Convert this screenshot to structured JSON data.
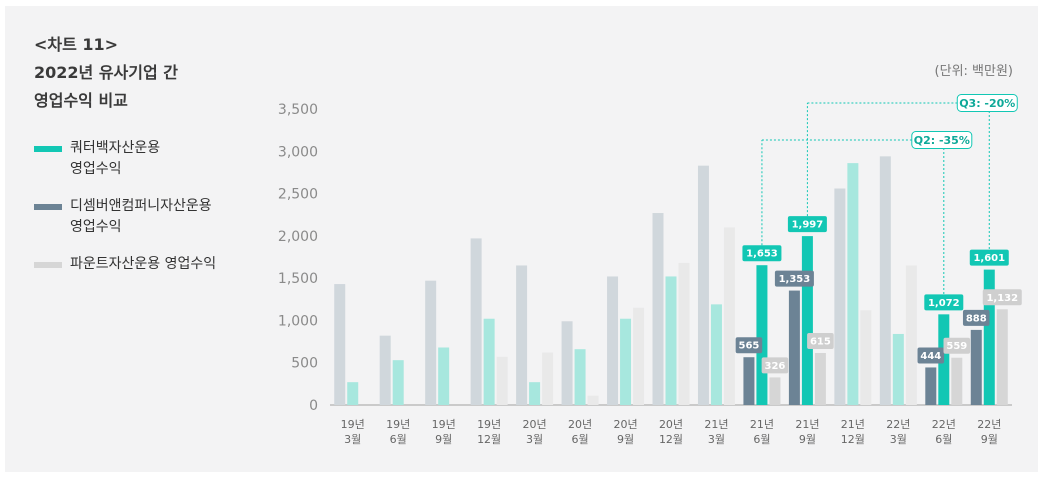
{
  "title": {
    "line1": "<차트 11>",
    "line2": "2022년 유사기업 간",
    "line3": "영업수익 비교"
  },
  "unit_label": "(단위: 백만원)",
  "legend": [
    {
      "line1": "쿼터백자산운용",
      "line2": "영업수익",
      "color": "#12c7b4"
    },
    {
      "line1": "디셈버앤컴퍼니자산운용",
      "line2": "영업수익",
      "color": "#6c8395"
    },
    {
      "line1": "파운트자산운용 영업수익",
      "line2": "",
      "color": "#d6d6d6"
    }
  ],
  "chart_data": {
    "type": "bar",
    "categories": [
      [
        "19년",
        "3월"
      ],
      [
        "19년",
        "6월"
      ],
      [
        "19년",
        "9월"
      ],
      [
        "19년",
        "12월"
      ],
      [
        "20년",
        "3월"
      ],
      [
        "20년",
        "6월"
      ],
      [
        "20년",
        "9월"
      ],
      [
        "20년",
        "12월"
      ],
      [
        "21년",
        "3월"
      ],
      [
        "21년",
        "6월"
      ],
      [
        "21년",
        "9월"
      ],
      [
        "21년",
        "12월"
      ],
      [
        "22년",
        "3월"
      ],
      [
        "22년",
        "6월"
      ],
      [
        "22년",
        "9월"
      ]
    ],
    "ylim": [
      0,
      3500
    ],
    "yticks": [
      0,
      500,
      1000,
      1500,
      2000,
      2500,
      3000,
      3500
    ],
    "ytick_labels": [
      "0",
      "500",
      "1,000",
      "1,500",
      "2,000",
      "2,500",
      "3,000",
      "3,500"
    ],
    "highlight_categories": [
      9,
      10,
      13,
      14
    ],
    "series": [
      {
        "name": "디셈버앤컴퍼니자산운용 영업수익",
        "color": "#6c8395",
        "faded_color": "#d0d7dc",
        "values": [
          1430,
          820,
          1470,
          1970,
          1650,
          990,
          1520,
          2270,
          2830,
          565,
          1353,
          2560,
          2940,
          444,
          888
        ],
        "labels": [
          null,
          null,
          null,
          null,
          null,
          null,
          null,
          null,
          null,
          "565",
          "1,353",
          null,
          null,
          "444",
          "888"
        ]
      },
      {
        "name": "쿼터백자산운용 영업수익",
        "color": "#12c7b4",
        "faded_color": "#a7e7de",
        "values": [
          270,
          530,
          680,
          1020,
          270,
          660,
          1020,
          1520,
          1190,
          1653,
          1997,
          2860,
          840,
          1072,
          1601
        ],
        "labels": [
          null,
          null,
          null,
          null,
          null,
          null,
          null,
          null,
          null,
          "1,653",
          "1,997",
          null,
          null,
          "1,072",
          "1,601"
        ]
      },
      {
        "name": "파운트자산운용 영업수익",
        "color": "#d6d6d6",
        "faded_color": "#e9e9e9",
        "values": [
          0,
          0,
          0,
          570,
          620,
          110,
          1150,
          1680,
          2100,
          326,
          615,
          1120,
          1650,
          559,
          1132
        ],
        "labels": [
          null,
          null,
          null,
          null,
          null,
          null,
          null,
          null,
          null,
          "326",
          "615",
          null,
          null,
          "559",
          "1,132"
        ]
      }
    ],
    "annotations": [
      {
        "text": "Q2: -35%",
        "from_category": 9,
        "to_category": 13
      },
      {
        "text": "Q3: -20%",
        "from_category": 10,
        "to_category": 14
      }
    ]
  }
}
